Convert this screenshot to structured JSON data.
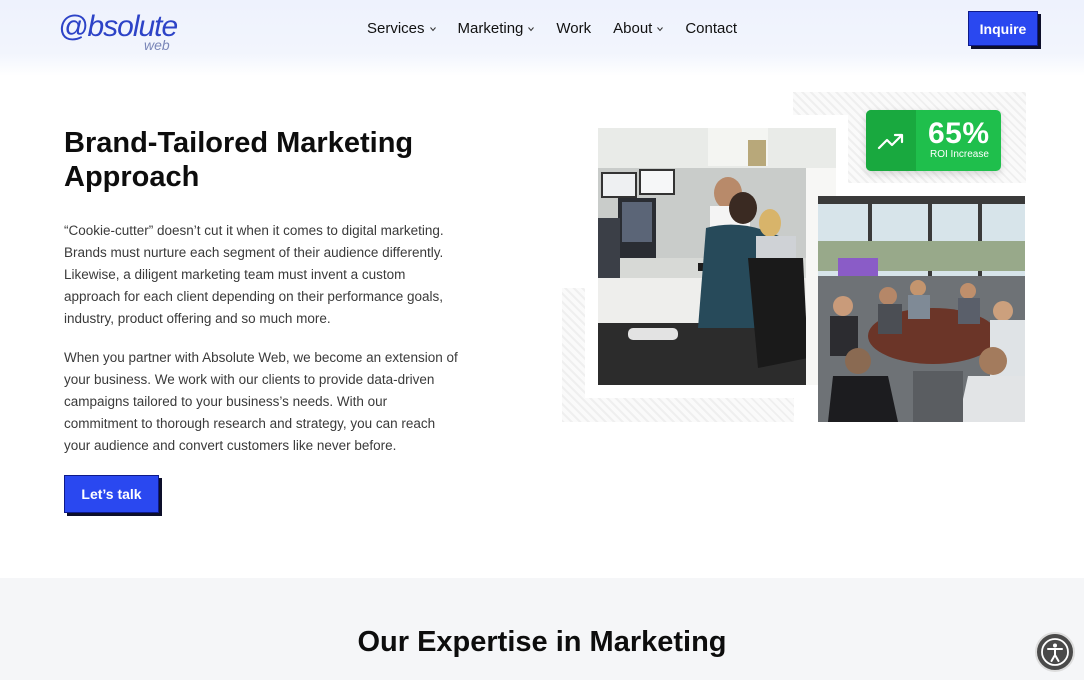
{
  "header": {
    "logo_main": "@bsolute",
    "logo_sub": "web",
    "nav": [
      {
        "label": "Services",
        "dropdown": true
      },
      {
        "label": "Marketing",
        "dropdown": true
      },
      {
        "label": "Work",
        "dropdown": false
      },
      {
        "label": "About",
        "dropdown": true
      },
      {
        "label": "Contact",
        "dropdown": false
      }
    ],
    "inquire_label": "Inquire"
  },
  "hero": {
    "title": "Brand-Tailored Marketing Approach",
    "paragraph_1": "“Cookie-cutter” doesn’t cut it when it comes to digital marketing. Brands must nurture each segment of their audience differently. Likewise, a diligent marketing team must invent a custom approach for each client depending on their performance goals, industry, product offering and so much more.",
    "paragraph_2": "When you partner with Absolute Web, we become an extension of your business. We work with our clients to provide data-driven campaigns tailored to your business’s needs. With our commitment to thorough research and strategy, you can reach your audience and convert customers like never before.",
    "cta_label": "Let’s talk"
  },
  "stat_card": {
    "value": "65%",
    "label": "ROI Increase",
    "icon": "trending-up-icon",
    "color": "#1fbf4c"
  },
  "expertise": {
    "title": "Our Expertise in Marketing"
  },
  "colors": {
    "accent": "#2a48f0",
    "brand_logo": "#2d43c7"
  },
  "accessibility": {
    "icon": "accessibility-icon"
  }
}
